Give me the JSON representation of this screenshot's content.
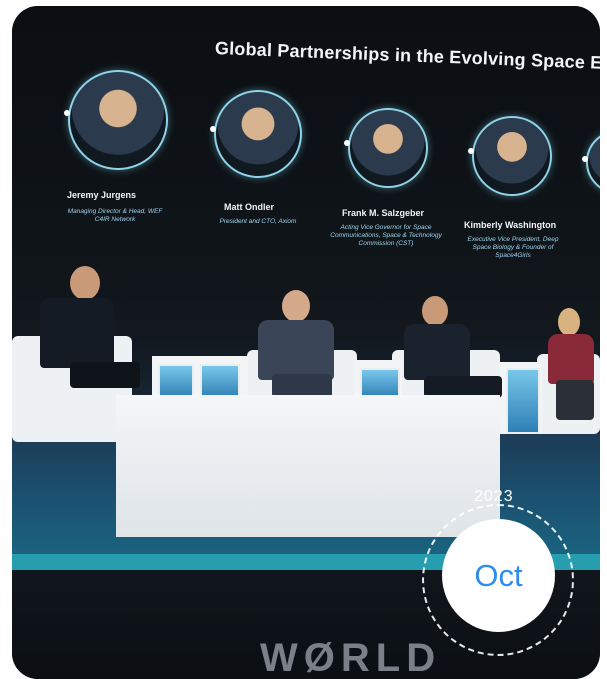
{
  "event": {
    "screen_title": "Global Partnerships in the Evolving Space Ec",
    "speakers": [
      {
        "name": "Jeremy Jurgens",
        "role": "Managing Director & Head, WEF C4IR Network"
      },
      {
        "name": "Matt Ondler",
        "role": "President and CTO, Axiom"
      },
      {
        "name": "Frank M. Salzgeber",
        "role": "Acting Vice Governor for Space Communications, Space & Technology Commission (CST)"
      },
      {
        "name": "Kimberly Washington",
        "role": "Executive Vice President, Deep Space Biology & Founder of Space4Girls"
      }
    ],
    "brand_text": "WØRLD"
  },
  "date_badge": {
    "year": "2023",
    "month": "Oct"
  },
  "colors": {
    "accent": "#2d8cf0",
    "ring": "#ffffff",
    "screen_text": "#f2f5f7",
    "role_text": "#9fd6ef"
  }
}
